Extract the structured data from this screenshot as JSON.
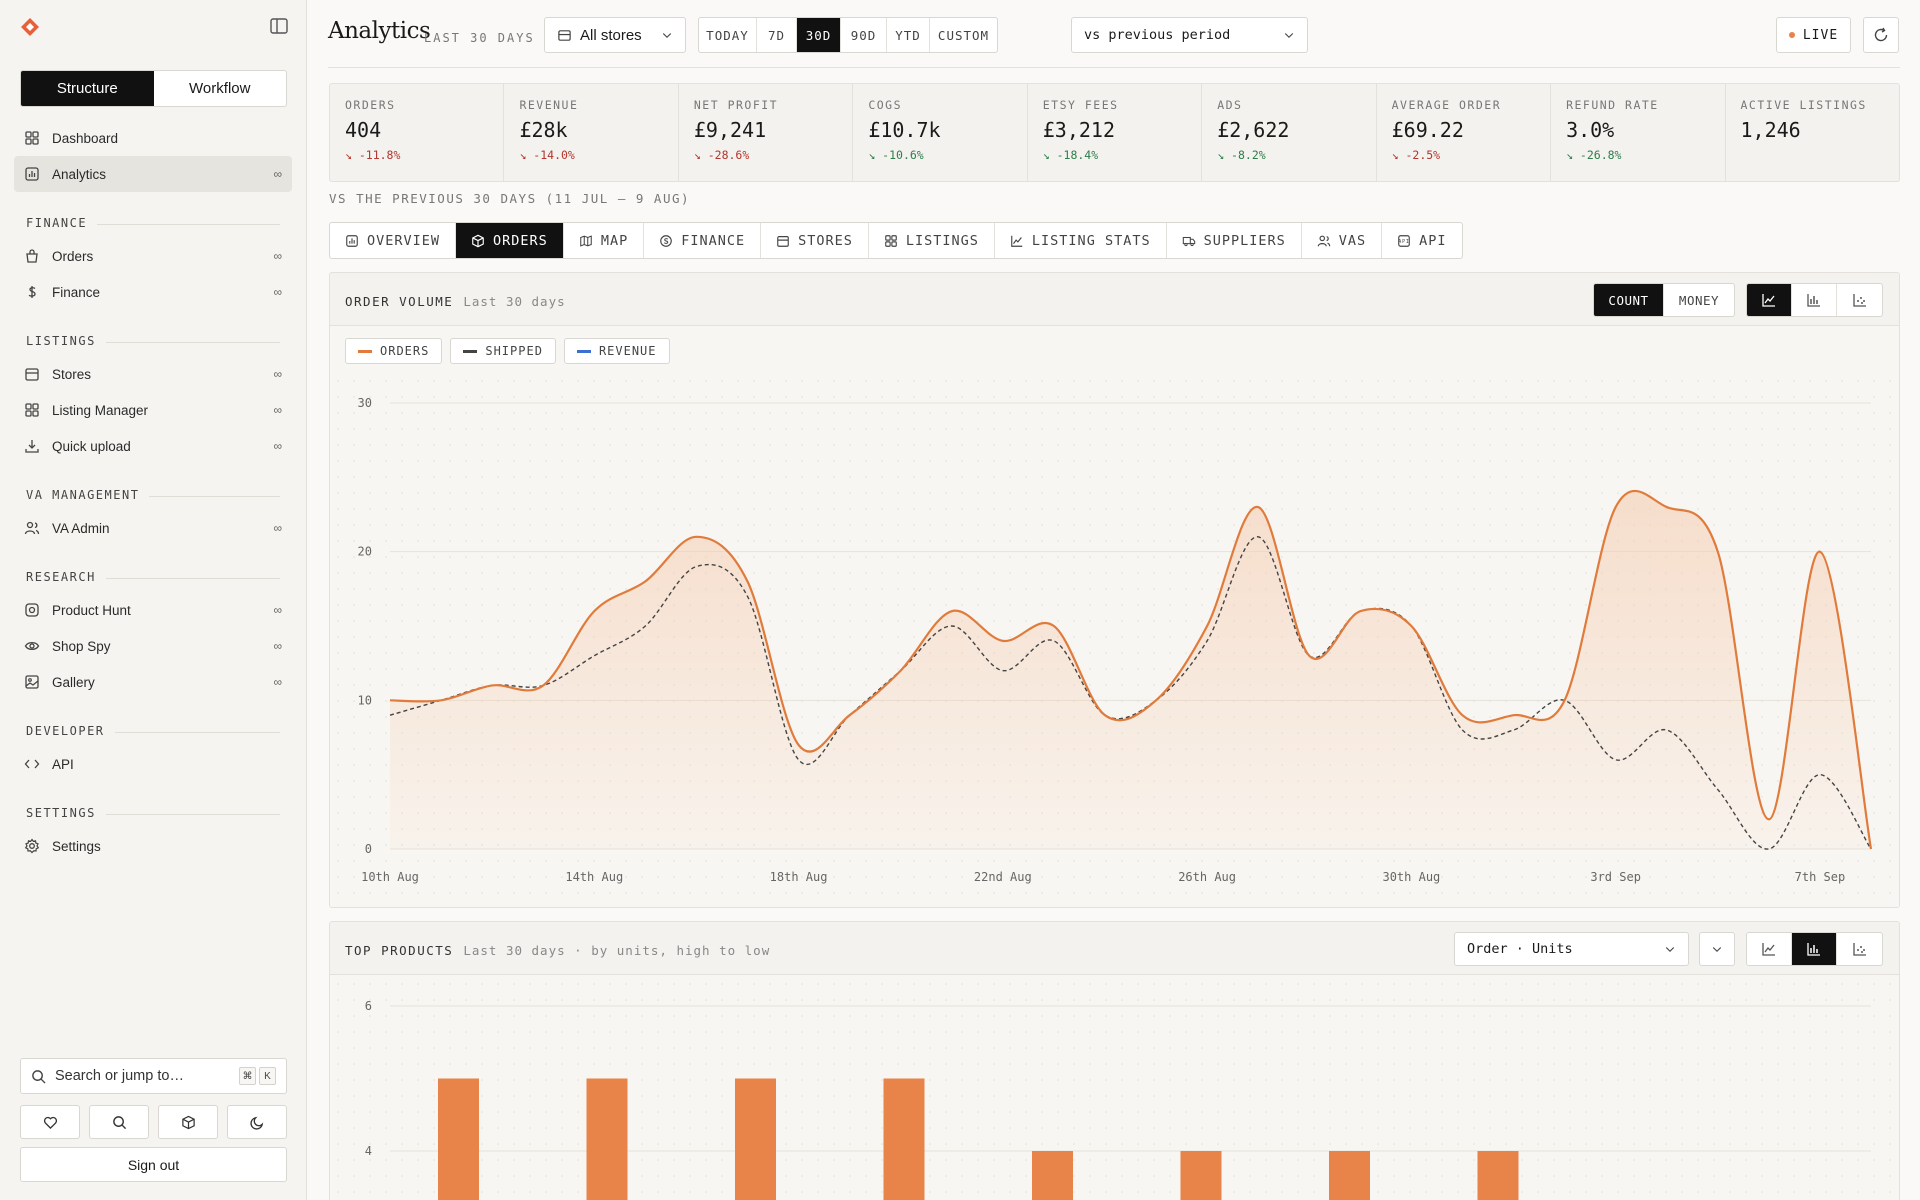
{
  "sidebar": {
    "segments": [
      "Structure",
      "Workflow"
    ],
    "items_top": [
      {
        "label": "Dashboard",
        "icon": "grid-icon",
        "inf": ""
      },
      {
        "label": "Analytics",
        "icon": "analytics-icon",
        "inf": "∞",
        "active": true
      }
    ],
    "sections": [
      {
        "title": "FINANCE",
        "items": [
          {
            "label": "Orders",
            "icon": "bag-icon",
            "inf": "∞"
          },
          {
            "label": "Finance",
            "icon": "dollar-icon",
            "inf": "∞"
          }
        ]
      },
      {
        "title": "LISTINGS",
        "items": [
          {
            "label": "Stores",
            "icon": "store-icon",
            "inf": "∞"
          },
          {
            "label": "Listing Manager",
            "icon": "grid-icon",
            "inf": "∞"
          },
          {
            "label": "Quick upload",
            "icon": "download-icon",
            "inf": "∞"
          }
        ]
      },
      {
        "title": "VA MANAGEMENT",
        "items": [
          {
            "label": "VA Admin",
            "icon": "users-icon",
            "inf": "∞"
          }
        ]
      },
      {
        "title": "RESEARCH",
        "items": [
          {
            "label": "Product Hunt",
            "icon": "target-icon",
            "inf": "∞"
          },
          {
            "label": "Shop Spy",
            "icon": "eye-icon",
            "inf": "∞"
          },
          {
            "label": "Gallery",
            "icon": "image-icon",
            "inf": "∞"
          }
        ]
      },
      {
        "title": "DEVELOPER",
        "items": [
          {
            "label": "API",
            "icon": "code-icon",
            "inf": ""
          }
        ]
      },
      {
        "title": "SETTINGS",
        "items": [
          {
            "label": "Settings",
            "icon": "gear-icon",
            "inf": ""
          }
        ]
      }
    ],
    "search_placeholder": "Search or jump to…",
    "search_keys": [
      "⌘",
      "K"
    ],
    "sign_out": "Sign out"
  },
  "header": {
    "title": "Analytics",
    "subtitle": "LAST 30 DAYS",
    "store": "All stores",
    "ranges": [
      "TODAY",
      "7D",
      "30D",
      "90D",
      "YTD",
      "CUSTOM"
    ],
    "active_range": "30D",
    "compare": "vs previous period",
    "live": "LIVE"
  },
  "kpis": [
    {
      "label": "ORDERS",
      "value": "404",
      "delta": "-11.8%",
      "tone": "red"
    },
    {
      "label": "REVENUE",
      "value": "£28k",
      "delta": "-14.0%",
      "tone": "red"
    },
    {
      "label": "NET PROFIT",
      "value": "£9,241",
      "delta": "-28.6%",
      "tone": "red"
    },
    {
      "label": "COGS",
      "value": "£10.7k",
      "delta": "-10.6%",
      "tone": "green"
    },
    {
      "label": "ETSY FEES",
      "value": "£3,212",
      "delta": "-18.4%",
      "tone": "green"
    },
    {
      "label": "ADS",
      "value": "£2,622",
      "delta": "-8.2%",
      "tone": "green"
    },
    {
      "label": "AVERAGE ORDER",
      "value": "£69.22",
      "delta": "-2.5%",
      "tone": "red"
    },
    {
      "label": "REFUND RATE",
      "value": "3.0%",
      "delta": "-26.8%",
      "tone": "green"
    },
    {
      "label": "ACTIVE LISTINGS",
      "value": "1,246",
      "delta": "",
      "tone": ""
    }
  ],
  "vs_note": "VS THE PREVIOUS 30 DAYS (11 JUL – 9 AUG)",
  "tabs": [
    "OVERVIEW",
    "ORDERS",
    "MAP",
    "FINANCE",
    "STORES",
    "LISTINGS",
    "LISTING STATS",
    "SUPPLIERS",
    "VAS",
    "API"
  ],
  "active_tab": "ORDERS",
  "order_volume": {
    "title": "ORDER VOLUME",
    "subtitle": "Last 30 days",
    "toggle": [
      "COUNT",
      "MONEY"
    ],
    "legend": [
      {
        "name": "ORDERS",
        "color": "#e07b3c"
      },
      {
        "name": "SHIPPED",
        "color": "#444444"
      },
      {
        "name": "REVENUE",
        "color": "#3b6fd4"
      }
    ]
  },
  "top_products": {
    "title": "TOP PRODUCTS",
    "subtitle": "Last 30 days · by units, high to low",
    "select": "Order · Units"
  },
  "chart_data": [
    {
      "type": "line",
      "x": [
        "10th Aug",
        "11th Aug",
        "12th Aug",
        "13th Aug",
        "14th Aug",
        "15th Aug",
        "16th Aug",
        "17th Aug",
        "18th Aug",
        "19th Aug",
        "20th Aug",
        "21st Aug",
        "22nd Aug",
        "23rd Aug",
        "24th Aug",
        "25th Aug",
        "26th Aug",
        "27th Aug",
        "28th Aug",
        "29th Aug",
        "30th Aug",
        "31st Aug",
        "1st Sep",
        "2nd Sep",
        "3rd Sep",
        "4th Sep",
        "5th Sep",
        "6th Sep",
        "7th Sep",
        "8th Sep"
      ],
      "xticks": [
        "10th Aug",
        "14th Aug",
        "18th Aug",
        "22nd Aug",
        "26th Aug",
        "30th Aug",
        "3rd Sep",
        "7th Sep"
      ],
      "series": [
        {
          "name": "ORDERS",
          "values": [
            10,
            10,
            11,
            11,
            16,
            18,
            21,
            18,
            7,
            9,
            12,
            16,
            14,
            15,
            9,
            10,
            15,
            23,
            13,
            16,
            15,
            9,
            9,
            10,
            23,
            23,
            20,
            2,
            20,
            0
          ]
        },
        {
          "name": "SHIPPED",
          "values": [
            9,
            10,
            11,
            11,
            13,
            15,
            19,
            17,
            6,
            9,
            12,
            15,
            12,
            14,
            9,
            10,
            14,
            21,
            13,
            16,
            15,
            8,
            8,
            10,
            6,
            8,
            4,
            0,
            5,
            0
          ]
        }
      ],
      "ylim": [
        0,
        30
      ],
      "yticks": [
        0,
        10,
        20,
        30
      ],
      "grid": true
    },
    {
      "type": "bar",
      "values": [
        5,
        5,
        5,
        5,
        4,
        4,
        4,
        4
      ],
      "ylim": [
        0,
        6
      ],
      "yticks": [
        4,
        6
      ],
      "grid": true
    }
  ]
}
